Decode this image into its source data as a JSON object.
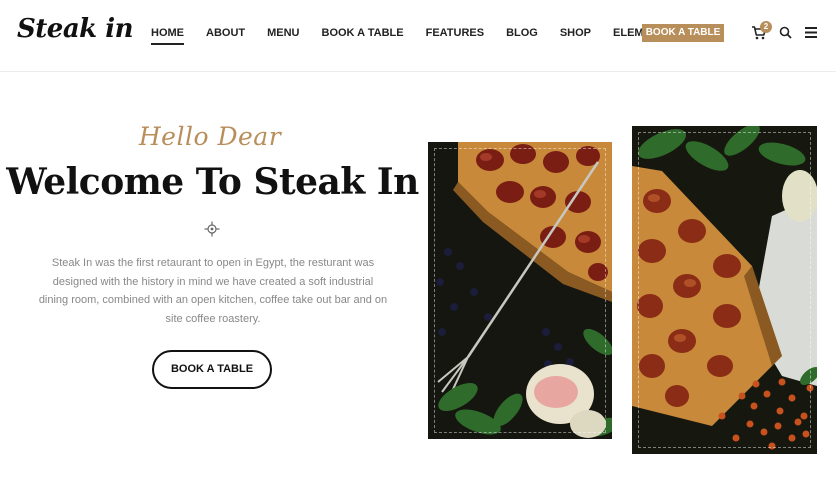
{
  "header": {
    "logo": "Steak in",
    "nav": [
      "HOME",
      "ABOUT",
      "MENU",
      "BOOK A TABLE",
      "FEATURES",
      "BLOG",
      "SHOP",
      "ELEMENTS"
    ],
    "active": "HOME",
    "book_label": "BOOK A TABLE",
    "cart_count": "2"
  },
  "hero": {
    "script": "Hello Dear",
    "title": "Welcome To Steak In",
    "description": "Steak In was the first retaurant to open in Egypt, the resturant was designed with the history in mind we have created a soft industrial dining room, combined with an open kitchen, coffee take out bar and on site coffee roastery.",
    "button": "BOOK A TABLE"
  },
  "images": [
    "food-photo-tart-fork",
    "food-photo-tart-herbs"
  ],
  "colors": {
    "accent": "#b88e5a",
    "text": "#111111",
    "muted": "#888888"
  }
}
